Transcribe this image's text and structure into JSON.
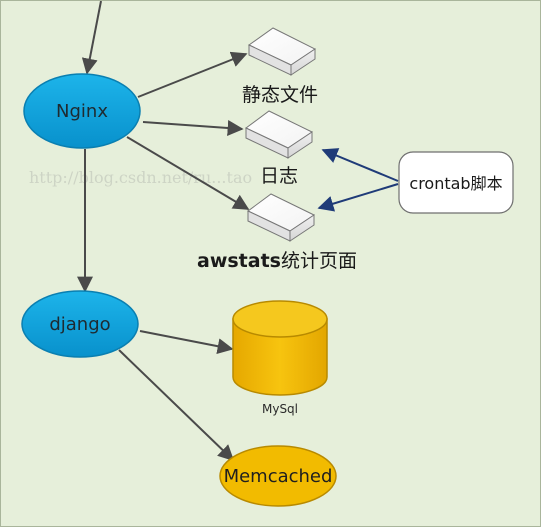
{
  "diagram": {
    "nodes": {
      "nginx": "Nginx",
      "django": "django",
      "memcached": "Memcached",
      "mysql": "MySql",
      "crontab": "crontab脚本"
    },
    "boxes": {
      "static_files": "静态文件",
      "log": "日志",
      "awstats_prefix": "awstats",
      "awstats_suffix": "统计页面"
    },
    "watermark": "http://blog.csdn.net/ru...tao"
  },
  "colors": {
    "background": "#e6efda",
    "ellipse_fill": "#0ea5dd",
    "ellipse_stroke": "#0a7fb1",
    "db_fill": "#f2bb00",
    "db_stroke": "#b88a00",
    "arrow_gray": "#4a4a4a",
    "arrow_blue": "#1f3b78"
  }
}
